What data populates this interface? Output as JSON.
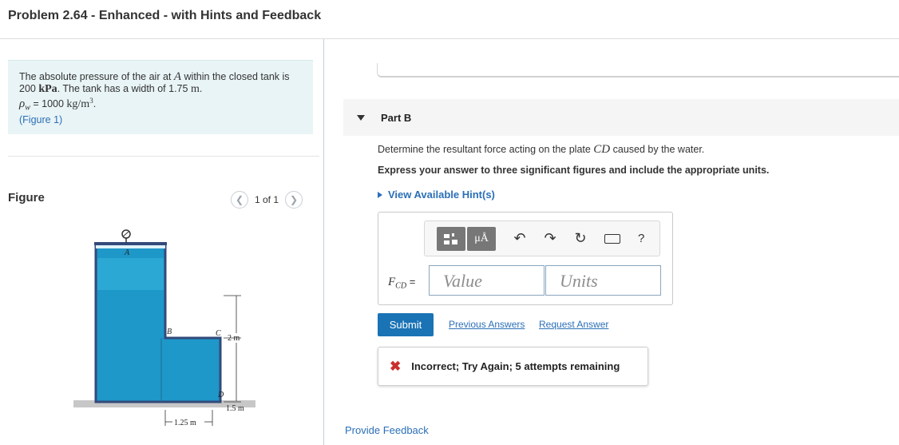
{
  "header": {
    "title": "Problem 2.64 - Enhanced - with Hints and Feedback"
  },
  "problem": {
    "line1": "The absolute pressure of the air at ",
    "point_a": "A",
    "line1_end": " within the closed tank is",
    "pressure_value": "200",
    "pressure_unit": "kPa",
    "line2_mid": ". The tank has a width of 1.75 ",
    "width_unit": "m",
    "line2_end": ".",
    "rho_symbol": "ρ",
    "rho_sub": "w",
    "rho_value": " = 1000 ",
    "rho_unit": "kg/m",
    "rho_exp": "3",
    "rho_end": ".",
    "figure_link": "(Figure 1)"
  },
  "figure": {
    "label": "Figure",
    "counter": "1 of 1",
    "prev_icon": "chevron-left-icon",
    "next_icon": "chevron-right-icon",
    "labels": {
      "a": "A",
      "b": "B",
      "c": "C",
      "d": "D",
      "dim_top": "2 m",
      "dim_bottom": "1.5 m",
      "dim_width": "1.25 m"
    },
    "colors": {
      "water": "#1e97c9",
      "water_light": "#39b6de",
      "tank_frame": "#324a7a",
      "ground": "#c7c7c7"
    }
  },
  "part": {
    "title": "Part B",
    "question_pre": "Determine the resultant force acting on the plate ",
    "question_var": "CD",
    "question_post": " caused by the water.",
    "instruction": "Express your answer to three significant figures and include the appropriate units.",
    "hints_label": "View Available Hint(s)"
  },
  "toolbar": {
    "templates_icon": "templates-icon",
    "units_label": "μÅ",
    "undo_icon": "undo-icon",
    "redo_icon": "redo-icon",
    "reset_icon": "reset-icon",
    "keyboard_icon": "keyboard-icon",
    "help_label": "?"
  },
  "answer": {
    "variable": "F",
    "variable_sub": "CD",
    "equals": " =",
    "value_placeholder": "Value",
    "units_placeholder": "Units"
  },
  "actions": {
    "submit": "Submit",
    "previous_answers": "Previous Answers",
    "request_answer": "Request Answer"
  },
  "feedback": {
    "icon": "x-icon",
    "message": "Incorrect; Try Again; 5 attempts remaining",
    "color": "#c9302c"
  },
  "footer": {
    "provide_feedback": "Provide Feedback"
  }
}
